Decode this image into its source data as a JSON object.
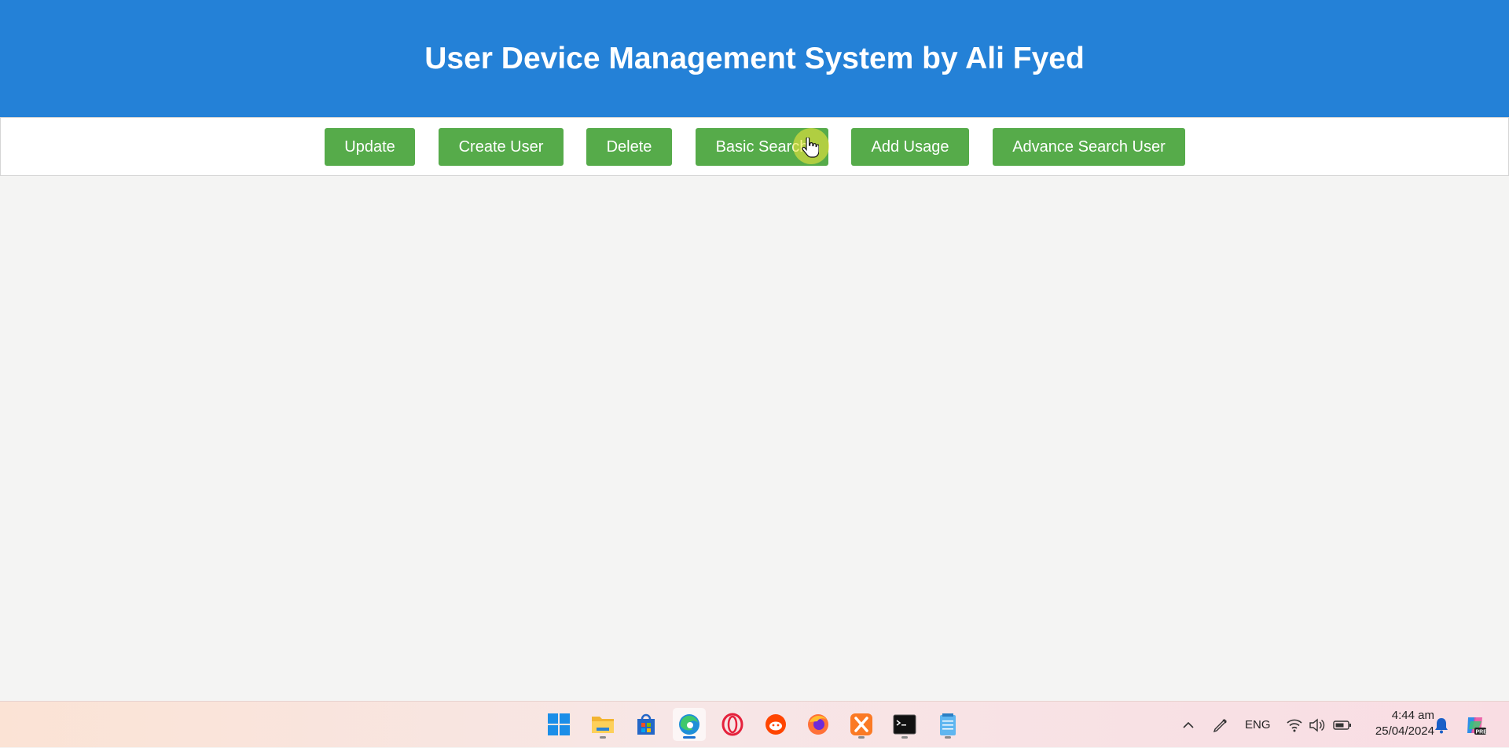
{
  "header": {
    "title": "User Device Management System by Ali Fyed"
  },
  "toolbar": {
    "update_label": "Update",
    "create_user_label": "Create User",
    "delete_label": "Delete",
    "basic_search_label": "Basic Search",
    "add_usage_label": "Add Usage",
    "advance_search_label": "Advance Search User"
  },
  "colors": {
    "header_bg": "#2481d7",
    "button_bg": "#56ab4a",
    "page_bg": "#f4f4f3"
  },
  "taskbar": {
    "icons": [
      "windows-start-icon",
      "file-explorer-icon",
      "microsoft-store-icon",
      "edge-browser-icon",
      "opera-browser-icon",
      "reddit-icon",
      "firefox-icon",
      "xampp-icon",
      "terminal-icon",
      "notepad-icon"
    ],
    "active_app": "edge-browser-icon",
    "language": "ENG",
    "time": "4:44 am",
    "date": "25/04/2024"
  }
}
